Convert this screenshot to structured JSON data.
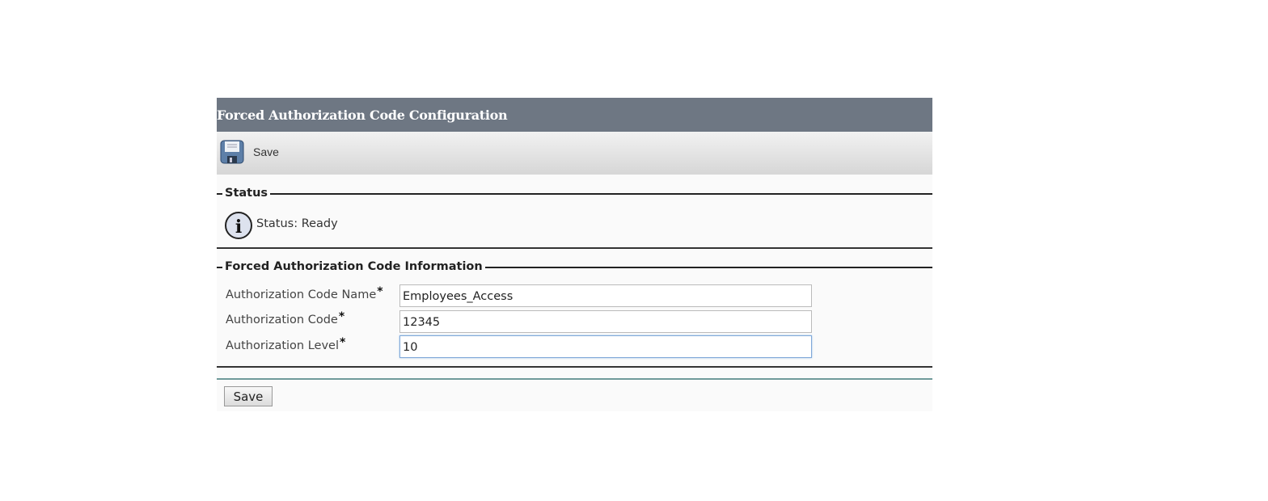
{
  "header": {
    "title": "Forced Authorization Code Configuration"
  },
  "toolbar": {
    "save_label": "Save"
  },
  "status": {
    "legend": "Status",
    "text": "Status: Ready"
  },
  "info": {
    "legend": "Forced Authorization Code Information",
    "fields": [
      {
        "label": "Authorization Code Name",
        "required": "*",
        "value": "Employees_Access"
      },
      {
        "label": "Authorization Code",
        "required": "*",
        "value": "12345"
      },
      {
        "label": "Authorization Level",
        "required": "*",
        "value": "10"
      }
    ]
  },
  "footer": {
    "save_label": "Save"
  },
  "colors": {
    "header": "#6e7783",
    "focus": "#7fa8d8"
  }
}
